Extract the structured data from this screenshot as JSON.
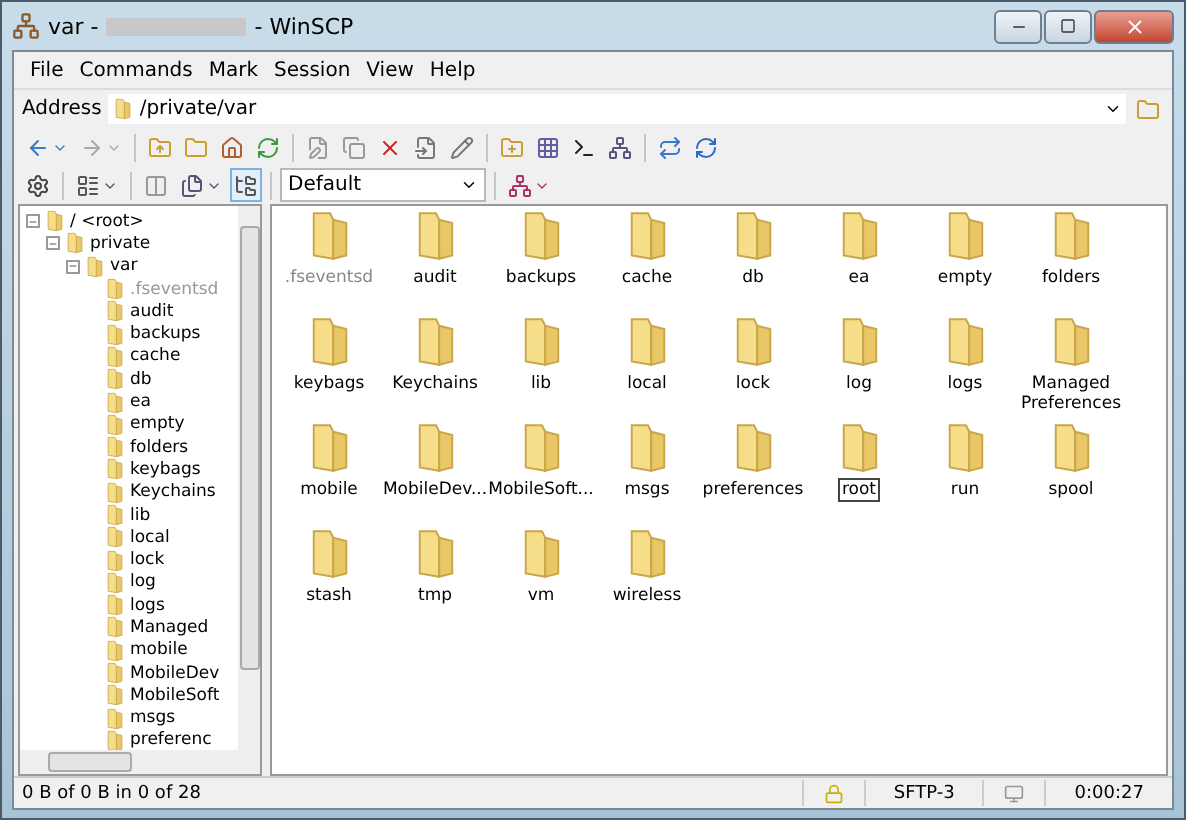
{
  "window": {
    "title_prefix": "var -",
    "title_suffix": "- WinSCP"
  },
  "menu": [
    "File",
    "Commands",
    "Mark",
    "Session",
    "View",
    "Help"
  ],
  "address": {
    "label": "Address",
    "value": "/private/var"
  },
  "profile": {
    "value": "Default"
  },
  "tree": [
    {
      "name": "/ <root>",
      "expanded": true,
      "hidden": false,
      "children": [
        {
          "name": "private",
          "expanded": true,
          "hidden": false,
          "children": [
            {
              "name": "var",
              "expanded": true,
              "hidden": false,
              "children": [
                {
                  "name": ".fseventsd",
                  "hidden": true
                },
                {
                  "name": "audit",
                  "hidden": false
                },
                {
                  "name": "backups",
                  "hidden": false
                },
                {
                  "name": "cache",
                  "hidden": false
                },
                {
                  "name": "db",
                  "hidden": false
                },
                {
                  "name": "ea",
                  "hidden": false
                },
                {
                  "name": "empty",
                  "hidden": false
                },
                {
                  "name": "folders",
                  "hidden": false
                },
                {
                  "name": "keybags",
                  "hidden": false
                },
                {
                  "name": "Keychains",
                  "hidden": false
                },
                {
                  "name": "lib",
                  "hidden": false
                },
                {
                  "name": "local",
                  "hidden": false
                },
                {
                  "name": "lock",
                  "hidden": false
                },
                {
                  "name": "log",
                  "hidden": false
                },
                {
                  "name": "logs",
                  "hidden": false
                },
                {
                  "name": "Managed",
                  "hidden": false
                },
                {
                  "name": "mobile",
                  "hidden": false
                },
                {
                  "name": "MobileDev",
                  "hidden": false
                },
                {
                  "name": "MobileSoft",
                  "hidden": false
                },
                {
                  "name": "msgs",
                  "hidden": false
                },
                {
                  "name": "preferenc",
                  "hidden": false
                }
              ]
            }
          ]
        }
      ]
    }
  ],
  "files": [
    {
      "name": ".fseventsd",
      "hidden": true,
      "selected": false
    },
    {
      "name": "audit",
      "hidden": false,
      "selected": false
    },
    {
      "name": "backups",
      "hidden": false,
      "selected": false
    },
    {
      "name": "cache",
      "hidden": false,
      "selected": false
    },
    {
      "name": "db",
      "hidden": false,
      "selected": false
    },
    {
      "name": "ea",
      "hidden": false,
      "selected": false
    },
    {
      "name": "empty",
      "hidden": false,
      "selected": false
    },
    {
      "name": "folders",
      "hidden": false,
      "selected": false
    },
    {
      "name": "keybags",
      "hidden": false,
      "selected": false
    },
    {
      "name": "Keychains",
      "hidden": false,
      "selected": false
    },
    {
      "name": "lib",
      "hidden": false,
      "selected": false
    },
    {
      "name": "local",
      "hidden": false,
      "selected": false
    },
    {
      "name": "lock",
      "hidden": false,
      "selected": false
    },
    {
      "name": "log",
      "hidden": false,
      "selected": false
    },
    {
      "name": "logs",
      "hidden": false,
      "selected": false
    },
    {
      "name": "Managed Preferences",
      "hidden": false,
      "selected": false
    },
    {
      "name": "mobile",
      "hidden": false,
      "selected": false
    },
    {
      "name": "MobileDev...",
      "hidden": false,
      "selected": false
    },
    {
      "name": "MobileSoft...",
      "hidden": false,
      "selected": false
    },
    {
      "name": "msgs",
      "hidden": false,
      "selected": false
    },
    {
      "name": "preferences",
      "hidden": false,
      "selected": false
    },
    {
      "name": "root",
      "hidden": false,
      "selected": true
    },
    {
      "name": "run",
      "hidden": false,
      "selected": false
    },
    {
      "name": "spool",
      "hidden": false,
      "selected": false
    },
    {
      "name": "stash",
      "hidden": false,
      "selected": false
    },
    {
      "name": "tmp",
      "hidden": false,
      "selected": false
    },
    {
      "name": "vm",
      "hidden": false,
      "selected": false
    },
    {
      "name": "wireless",
      "hidden": false,
      "selected": false
    }
  ],
  "status_bar": {
    "summary": "0 B of 0 B in 0 of 28",
    "protocol": "SFTP-3",
    "elapsed": "0:00:27"
  }
}
